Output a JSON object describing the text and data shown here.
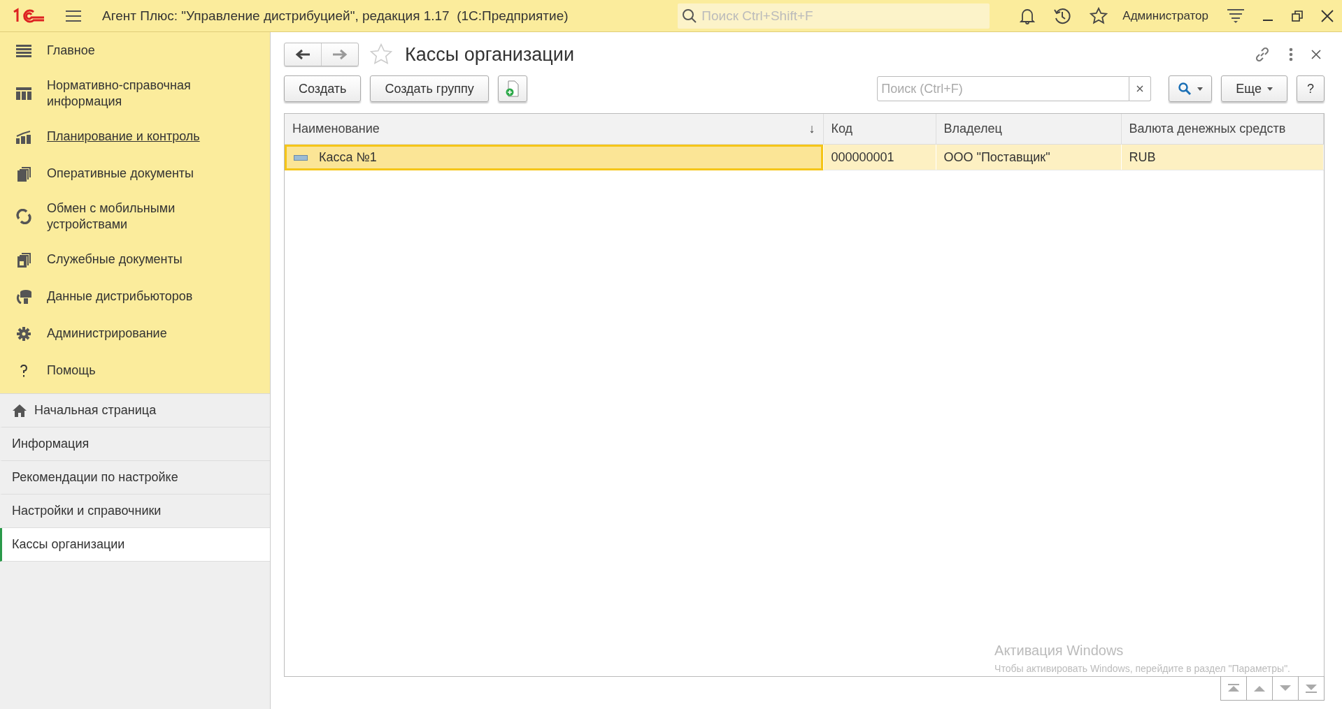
{
  "window": {
    "title": "Агент Плюс: \"Управление дистрибуцией\", редакция 1.17  (1С:Предприятие)",
    "search_placeholder": "Поиск Ctrl+Shift+F",
    "user": "Администратор"
  },
  "sections": [
    {
      "label": "Главное",
      "selected": false
    },
    {
      "label": "Нормативно-справочная информация",
      "selected": false
    },
    {
      "label": "Планирование и контроль",
      "selected": true
    },
    {
      "label": "Оперативные документы",
      "selected": false
    },
    {
      "label": "Обмен с мобильными устройствами",
      "selected": false
    },
    {
      "label": "Служебные документы",
      "selected": false
    },
    {
      "label": "Данные дистрибьюторов",
      "selected": false
    },
    {
      "label": "Администрирование",
      "selected": false
    },
    {
      "label": "Помощь",
      "selected": false
    }
  ],
  "open_pages": [
    {
      "label": "Начальная страница",
      "selected": false
    },
    {
      "label": "Информация",
      "selected": false
    },
    {
      "label": "Рекомендации по настройке",
      "selected": false
    },
    {
      "label": "Настройки и справочники",
      "selected": false
    },
    {
      "label": "Кассы организации",
      "selected": true
    }
  ],
  "form": {
    "title": "Кассы организации",
    "favorite": false,
    "buttons": [
      "Создать",
      "Создать группу"
    ],
    "search_placeholder": "Поиск (Ctrl+F)",
    "more": "Еще",
    "help": "?"
  },
  "table": {
    "columns": [
      {
        "label": "Наименование",
        "sort_mark": "↓"
      },
      {
        "label": "Код"
      },
      {
        "label": "Владелец"
      },
      {
        "label": "Валюта денежных средств"
      }
    ],
    "rows": [
      {
        "cells": [
          "Касса №1",
          "000000001",
          "ООО \"Поставщик\"",
          "RUB"
        ],
        "selected": true
      }
    ]
  },
  "os_notice": {
    "title": "Активация Windows",
    "text": "Чтобы активировать Windows, перейдите в раздел \"Параметры\"."
  }
}
